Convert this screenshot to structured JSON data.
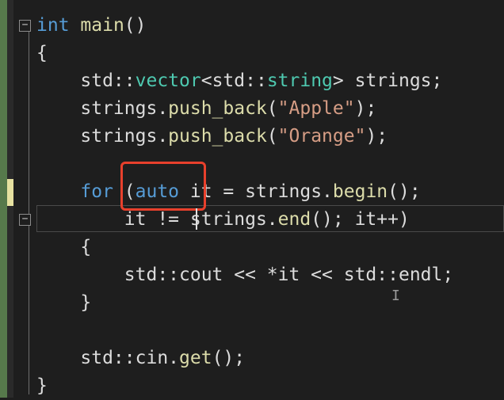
{
  "editor": {
    "lines": [
      [
        {
          "t": "int",
          "c": "kw"
        },
        {
          "t": " ",
          "c": "tx"
        },
        {
          "t": "main",
          "c": "fn"
        },
        {
          "t": "()",
          "c": "tx"
        }
      ],
      [
        {
          "t": "{",
          "c": "tx"
        }
      ],
      [
        {
          "t": "    std::",
          "c": "tx"
        },
        {
          "t": "vector",
          "c": "ty"
        },
        {
          "t": "<std::",
          "c": "tx"
        },
        {
          "t": "string",
          "c": "ty"
        },
        {
          "t": "> strings;",
          "c": "tx"
        }
      ],
      [
        {
          "t": "    strings.",
          "c": "tx"
        },
        {
          "t": "push_back",
          "c": "fn"
        },
        {
          "t": "(",
          "c": "tx"
        },
        {
          "t": "\"Apple\"",
          "c": "str"
        },
        {
          "t": ");",
          "c": "tx"
        }
      ],
      [
        {
          "t": "    strings.",
          "c": "tx"
        },
        {
          "t": "push_back",
          "c": "fn"
        },
        {
          "t": "(",
          "c": "tx"
        },
        {
          "t": "\"Orange\"",
          "c": "str"
        },
        {
          "t": ");",
          "c": "tx"
        }
      ],
      [],
      [
        {
          "t": "    ",
          "c": "tx"
        },
        {
          "t": "for",
          "c": "kw"
        },
        {
          "t": " (",
          "c": "tx"
        },
        {
          "t": "auto",
          "c": "kw"
        },
        {
          "t": " it = strings.",
          "c": "tx"
        },
        {
          "t": "begin",
          "c": "fn"
        },
        {
          "t": "();",
          "c": "tx"
        }
      ],
      [
        {
          "t": "        it != strings.",
          "c": "tx"
        },
        {
          "t": "end",
          "c": "fn"
        },
        {
          "t": "(); it++)",
          "c": "tx"
        }
      ],
      [
        {
          "t": "    {",
          "c": "tx"
        }
      ],
      [
        {
          "t": "        std::",
          "c": "tx"
        },
        {
          "t": "cout",
          "c": "tx"
        },
        {
          "t": " << *it << std::",
          "c": "tx"
        },
        {
          "t": "endl",
          "c": "tx"
        },
        {
          "t": ";",
          "c": "tx"
        }
      ],
      [
        {
          "t": "    }",
          "c": "tx"
        }
      ],
      [],
      [
        {
          "t": "    std::cin.",
          "c": "tx"
        },
        {
          "t": "get",
          "c": "fn"
        },
        {
          "t": "();",
          "c": "tx"
        }
      ],
      [
        {
          "t": "}",
          "c": "tx"
        }
      ]
    ],
    "fold_glyph": "−",
    "cursor_glyph": "I"
  },
  "colors": {
    "background": "#1e1e1e",
    "keyword": "#569cd6",
    "function": "#dcdcaa",
    "type": "#4ec9b0",
    "string": "#d69d85",
    "text": "#dcdcdc",
    "highlight_box": "#e8402c",
    "change_margin": "#56794b",
    "unsaved_change": "#e6e1a0"
  }
}
